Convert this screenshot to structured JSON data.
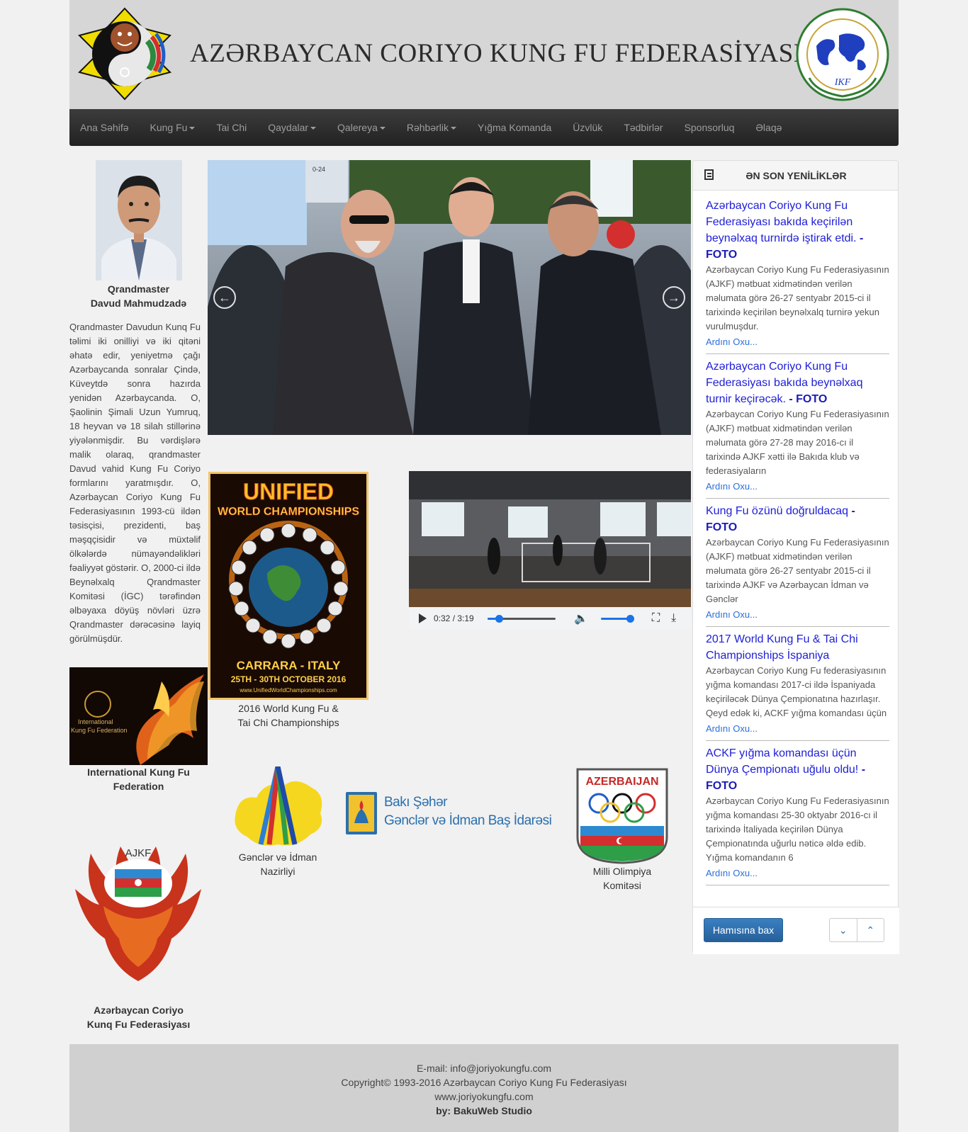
{
  "header": {
    "title": "AZƏRBAYCAN CORIYO KUNG FU FEDERASİYASI",
    "right_logo_text": "INTERNATIONAL KUNG FU FEDERATION",
    "right_logo_abbr": "IKF"
  },
  "nav": {
    "items": [
      {
        "label": "Ana Səhifə",
        "dropdown": false
      },
      {
        "label": "Kung Fu",
        "dropdown": true
      },
      {
        "label": "Tai Chi",
        "dropdown": false
      },
      {
        "label": "Qaydalar",
        "dropdown": true
      },
      {
        "label": "Qalereya",
        "dropdown": true
      },
      {
        "label": "Rəhbərlik",
        "dropdown": true
      },
      {
        "label": "Yığma Komanda",
        "dropdown": false
      },
      {
        "label": "Üzvlük",
        "dropdown": false
      },
      {
        "label": "Tədbirlər",
        "dropdown": false
      },
      {
        "label": "Sponsorluq",
        "dropdown": false
      },
      {
        "label": "Əlaqə",
        "dropdown": false
      }
    ]
  },
  "master": {
    "name_line1": "Qrandmaster",
    "name_line2": "Davud Mahmudzadə",
    "bio": "Qrandmaster Davudun Kunq Fu təlimi iki onilliyi və iki qitəni əhatə edir, yeniyetmə çağı Azərbaycanda sonralar Çində, Küveytdə sonra hazırda yenidən Azərbaycanda. O, Şaolinin Şimali Uzun Yumruq, 18 heyvan və 18 silah stillərinə yiyələnmişdir. Bu vərdişlərə malik olaraq, qrandmaster Davud vahid Kung Fu Coriyo formlarını yaratmışdır. O, Azərbaycan Coriyo Kung Fu Federasiyasının 1993-cü ildən təsisçisi, prezidenti, baş məşqçisidir və müxtəlif ölkələrdə nümayəndəlikləri fəaliyyət göstərir. O, 2000-ci ildə Beynəlxalq Qrandmaster Komitəsi (İGC) tərəfindən əlbəyaxa döyüş növləri üzrə Qrandmaster dərəcəsinə layiq görülmüşdür."
  },
  "ikf": {
    "banner_line1": "International",
    "banner_line2": "Kung Fu Federation",
    "caption_line1": "International Kung Fu",
    "caption_line2": "Federation"
  },
  "ajkf": {
    "logo_text": "AJKF",
    "caption_line1": "Azərbaycan Coriyo",
    "caption_line2": "Kunq Fu Federasiyası"
  },
  "carousel": {
    "prev_icon": "arrow-left-circle",
    "next_icon": "arrow-right-circle",
    "sign_text": "0-24"
  },
  "poster": {
    "line1": "UNIFIED",
    "line2": "WORLD CHAMPIONSHIPS",
    "place": "CARRARA - ITALY",
    "dates": "25TH - 30TH OCTOBER 2016",
    "url": "www.UnifiedWorldChampionships.com",
    "caption_line1": "2016 World Kung Fu &",
    "caption_line2": "Tai Chi Championships"
  },
  "video": {
    "time": "0:32 / 3:19",
    "progress_fraction": 0.167,
    "volume_fraction": 1.0
  },
  "sponsors": {
    "ministry_caption_line1": "Gənclər və İdman",
    "ministry_caption_line2": "Nazirliyi",
    "baku_line1": "Bakı Şəhər",
    "baku_line2": "Gənclər və İdman Baş İdarəsi",
    "olympic_title": "AZERBAIJAN",
    "olympic_caption_line1": "Milli Olimpiya",
    "olympic_caption_line2": "Komitəsi"
  },
  "news": {
    "heading": "ƏN SON YENİLİKLƏR",
    "more_label": "Ardını Oxu...",
    "items": [
      {
        "title": "Azərbaycan Coriyo Kung Fu Federasiyası bakıda keçirilən beynəlxaq turnirdə iştirak etdi.",
        "foto": " - FOTO",
        "body": "Azərbaycan Coriyo Kung Fu Federasiyasının  (AJKF) mətbuat xidmətindən verilən məlumata görə 26-27 sentyabr 2015-ci il tarixində keçirilən beynəlxalq turnirə yekun vurulmuşdur."
      },
      {
        "title": "Azərbaycan Coriyo Kung Fu Federasiyası bakıda beynəlxaq turnir keçirəcək.",
        "foto": " - FOTO",
        "body": "Azərbaycan Coriyo Kung Fu Federasiyasının  (AJKF) mətbuat xidmətindən verilən məlumata görə 27-28 may 2016-cı il tarixində AJKF xətti ilə Bakıda klub və federasiyaların"
      },
      {
        "title": "Kung Fu özünü doğruldacaq",
        "foto": " - FOTO",
        "body": "Azərbaycan Coriyo Kung Fu Federasiyasının  (AJKF) mətbuat xidmətindən verilən məlumata görə 26-27 sentyabr 2015-ci il tarixində AJKF və Azərbaycan İdman və Gənclər"
      },
      {
        "title": "2017 World Kung Fu & Tai Chi Championships İspaniya",
        "foto": "",
        "body": "Azərbaycan Coriyo Kung Fu federasiyasının yığma komandası 2017-ci ildə İspaniyada keçiriləcək Dünya Çempionatına hazırlaşır. Qeyd edək ki, ACKF yığma komandası üçün"
      },
      {
        "title": "ACKF yığma komandası üçün Dünya Çempionatı uğulu oldu!",
        "foto": " - FOTO",
        "body": "Azərbaycan Coriyo Kung Fu Federasiyasının yığma komandası 25-30 oktyabr 2016-cı il tarixində İtaliyada keçirilən Dünya Çempionatında uğurlu nəticə əldə edib. Yığma komandanın 6"
      }
    ],
    "all_button": "Hamısına bax",
    "down_icon": "chevron-down",
    "up_icon": "chevron-up"
  },
  "footer": {
    "email": "E-mail: info@joriyokungfu.com",
    "copyright": "Copyright© 1993-2016   Azərbaycan Coriyo Kung Fu Federasiyası",
    "site": "www.joriyokungfu.com",
    "credit": "by: BakuWeb Studio"
  }
}
